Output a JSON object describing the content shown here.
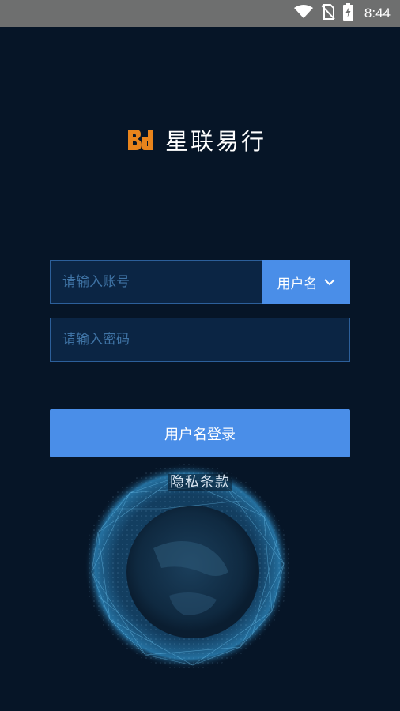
{
  "status_bar": {
    "time": "8:44"
  },
  "logo": {
    "text": "星联易行"
  },
  "account_field": {
    "placeholder": "请输入账号",
    "value": ""
  },
  "login_type": {
    "selected": "用户名"
  },
  "password_field": {
    "placeholder": "请输入密码",
    "value": ""
  },
  "login_button": {
    "label": "用户名登录"
  },
  "privacy": {
    "label": "隐私条款"
  },
  "colors": {
    "background": "#061527",
    "accent": "#4a8ee8",
    "logo_orange": "#e8841c",
    "status_bar": "#6e6f6f"
  },
  "icons": [
    "wifi-icon",
    "no-sim-icon",
    "battery-charging-icon",
    "chevron-down-icon",
    "brand-logo-icon",
    "globe-graphic"
  ]
}
